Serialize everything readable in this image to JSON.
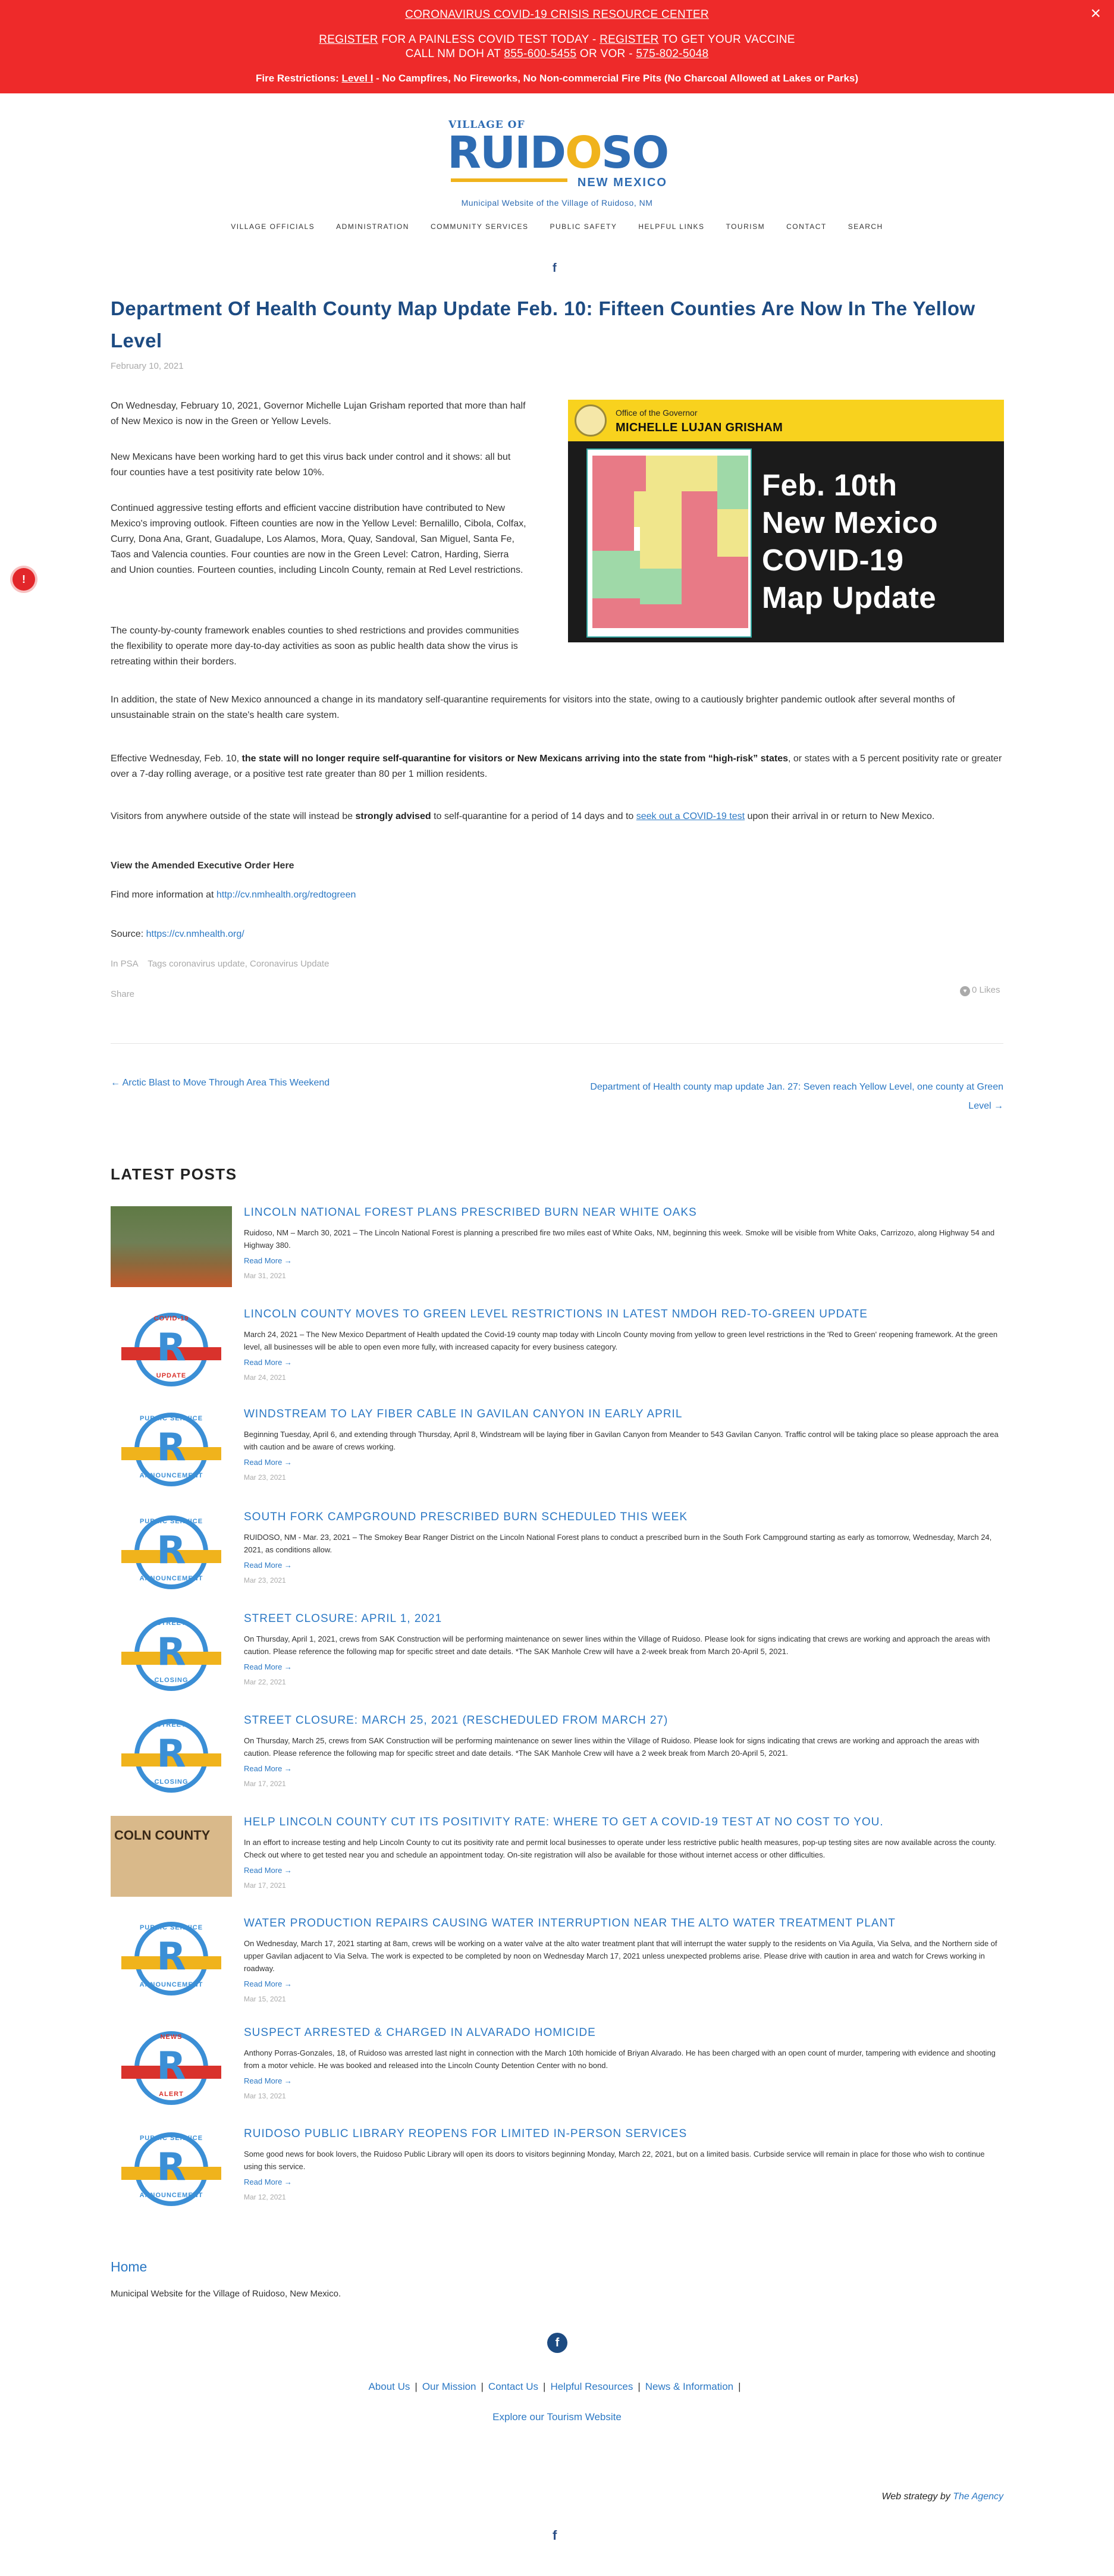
{
  "alert": {
    "line1": "CORONAVIRUS COVID-19 CRISIS RESOURCE CENTER",
    "register1": "REGISTER",
    "line2_mid": " FOR A PAINLESS COVID TEST TODAY - ",
    "register2": "REGISTER",
    "line2_end": " TO GET YOUR VACCINE",
    "line3_a": "CALL NM DOH AT ",
    "phone1": "855-600-5455",
    "line3_b": " OR VOR - ",
    "phone2": "575-802-5048",
    "fire_a": "Fire Restrictions: ",
    "fire_level": "Level I",
    "fire_b": " - No Campfires, No Fireworks, No Non-commercial Fire Pits (No Charcoal Allowed at Lakes or Parks)",
    "close": "×"
  },
  "header": {
    "logo_village": "VILLAGE OF",
    "logo_name_a": "RUID",
    "logo_name_b": "O",
    "logo_name_c": "SO",
    "logo_state": "NEW MEXICO",
    "tagline": "Municipal Website of the Village of Ruidoso, NM",
    "nav": [
      "VILLAGE OFFICIALS",
      "ADMINISTRATION",
      "COMMUNITY SERVICES",
      "PUBLIC SAFETY",
      "HELPFUL LINKS",
      "TOURISM",
      "CONTACT",
      "SEARCH"
    ],
    "fb": "f"
  },
  "article": {
    "title": "Department Of Health County Map Update Feb. 10: Fifteen Counties Are Now In The Yellow Level",
    "date": "February 10, 2021",
    "p1": "On Wednesday, February 10, 2021, Governor Michelle Lujan Grisham reported that more than half of New Mexico is now in the Green or Yellow Levels.",
    "p2": "New Mexicans have been working hard to get this virus back under control and it shows: all but four counties have a test positivity rate below 10%.",
    "p3": "Continued aggressive testing efforts and efficient vaccine distribution have contributed to New Mexico's improving outlook. Fifteen counties are now in the Yellow Level: Bernalillo, Cibola, Colfax, Curry, Dona Ana, Grant, Guadalupe, Los Alamos, Mora, Quay, Sandoval, San Miguel, Santa Fe, Taos and Valencia counties. Four counties are now in the Green Level: Catron, Harding, Sierra and Union counties. Fourteen counties, including Lincoln County, remain at Red Level restrictions.",
    "p4": "The county-by-county framework enables counties to shed restrictions and provides communities the flexibility to operate more day-to-day activities as soon as public health data show the virus is retreating within their borders.",
    "p5": "In addition, the state of New Mexico announced a change in its mandatory self-quarantine requirements for visitors into the state, owing to a cautiously brighter pandemic outlook after several months of unsustainable strain on the state's health care system.",
    "p6_a": "Effective Wednesday, Feb. 10, ",
    "p6_b": "the state will no longer require self-quarantine for visitors or New Mexicans arriving into the state from “high-risk” states",
    "p6_c": ", or states with a 5 percent positivity rate or greater over a 7-day rolling average, or a positive test rate greater than 80 per 1 million residents.",
    "p7_a": "Visitors from anywhere outside of the state will instead be ",
    "p7_b": "strongly advised",
    "p7_c": " to self-quarantine for a period of 14 days and to ",
    "p7_link": "seek out a COVID-19 test",
    "p7_d": " upon their arrival in or return to New Mexico.",
    "order_link": "View the Amended Executive Order Here",
    "more_a": "Find more information at ",
    "more_link": "http://cv.nmhealth.org/redtogreen",
    "source_a": "Source: ",
    "source_link": "https://cv.nmhealth.org/",
    "tags": "In PSA    Tags coronavirus update, Coronavirus Update",
    "share": "Share",
    "likes": "0 Likes",
    "prev": "← Arctic Blast to Move Through Area This Weekend",
    "next": "Department of Health county map update Jan. 27: Seven reach Yellow Level, one county at Green Level →"
  },
  "hero": {
    "office": "Office of the Governor",
    "governor": "MICHELLE LUJAN GRISHAM",
    "headline": [
      "Feb. 10th",
      "New Mexico",
      "COVID-19",
      "Map Update"
    ]
  },
  "latest": {
    "heading": "LATEST POSTS",
    "posts": [
      {
        "title": "Lincoln National Forest plans prescribed burn near White Oaks",
        "excerpt": "Ruidoso, NM – March 30, 2021 – The Lincoln National Forest is planning a prescribed fire two miles east of White Oaks, NM, beginning this week. Smoke will be visible from White Oaks, Carrizozo, along Highway 54 and Highway 380.",
        "more": "Read More →",
        "date": "Mar 31, 2021",
        "thumb": "fire"
      },
      {
        "title": "Lincoln County moves to Green Level restrictions in latest NMDOH Red-to-Green update",
        "excerpt": "March 24, 2021 – The New Mexico Department of Health updated the Covid-19 county map today with Lincoln County moving from yellow to green level restrictions in the 'Red to Green' reopening framework. At the green level, all businesses will be able to open even more fully, with increased capacity for every business category.",
        "more": "Read More →",
        "date": "Mar 24, 2021",
        "thumb": "covid"
      },
      {
        "title": "Windstream to lay fiber cable in Gavilan Canyon in early April",
        "excerpt": "Beginning Tuesday, April 6, and extending through Thursday, April 8, Windstream will be laying fiber in Gavilan Canyon from Meander to 543 Gavilan Canyon. Traffic control will be taking place so please approach the area with caution and be aware of crews working.",
        "more": "Read More →",
        "date": "Mar 23, 2021",
        "thumb": "psa"
      },
      {
        "title": "South Fork Campground prescribed burn scheduled this week",
        "excerpt": "RUIDOSO, NM - Mar. 23, 2021 – The Smokey Bear Ranger District on the Lincoln National Forest plans to conduct a prescribed burn in the South Fork Campground starting as early as tomorrow, Wednesday, March 24, 2021, as conditions allow.",
        "more": "Read More →",
        "date": "Mar 23, 2021",
        "thumb": "psa"
      },
      {
        "title": "Street Closure: April 1, 2021",
        "excerpt": "On Thursday, April 1, 2021, crews from SAK Construction will be performing maintenance on sewer lines within the Village of Ruidoso. Please look for signs indicating that crews are working and approach the areas with caution. Please reference the following map for specific street and date details. *The SAK Manhole Crew will have a 2-week break from March 20-April 5, 2021.",
        "more": "Read More →",
        "date": "Mar 22, 2021",
        "thumb": "street"
      },
      {
        "title": "Street Closure: March 25, 2021 (Rescheduled from March 27)",
        "excerpt": "On Thursday, March 25, crews from SAK Construction will be performing maintenance on sewer lines within the Village of Ruidoso. Please look for signs indicating that crews are working and approach the areas with caution. Please reference the following map for specific street and date details. *The SAK Manhole Crew will have a 2 week break from March 20-April 5, 2021.",
        "more": "Read More →",
        "date": "Mar 17, 2021",
        "thumb": "street"
      },
      {
        "title": "Help Lincoln County cut its positivity rate: Where to get a COVID-19 test at no cost to you.",
        "excerpt": "In an effort to increase testing and help Lincoln County to cut its positivity rate and permit local businesses to operate under less restrictive public health measures, pop-up testing sites are now available across the county. Check out where to get tested near you and schedule an appointment today. On-site registration will also be available for those without internet access or other difficulties.",
        "more": "Read More →",
        "date": "Mar 17, 2021",
        "thumb": "county"
      },
      {
        "title": "Water production repairs causing water interruption near the Alto Water Treatment Plant",
        "excerpt": "On Wednesday, March 17, 2021 starting at 8am, crews will be working on a water valve at the alto water treatment plant that will interrupt the water supply to the residents on Via Aguila, Via Selva, and the Northern side of upper Gavilan adjacent to Via Selva. The work is expected to be completed by noon on Wednesday March 17, 2021 unless unexpected problems arise. Please drive with caution in area and watch for Crews working in roadway.",
        "more": "Read More →",
        "date": "Mar 15, 2021",
        "thumb": "psa"
      },
      {
        "title": "Suspect arrested & charged in Alvarado homicide",
        "excerpt": "Anthony Porras-Gonzales, 18, of Ruidoso was arrested last night in connection with the March 10th homicide of Briyan Alvarado. He has been charged with an open count of murder, tampering with evidence and shooting from a motor vehicle. He was booked and released into the Lincoln County Detention Center with no bond.",
        "more": "Read More →",
        "date": "Mar 13, 2021",
        "thumb": "news"
      },
      {
        "title": "Ruidoso Public Library reopens for limited in-person services",
        "excerpt": "Some good news for book lovers, the Ruidoso Public Library will open its doors to visitors beginning Monday, March 22, 2021, but on a limited basis. Curbside service will remain in place for those who wish to continue using this service.",
        "more": "Read More →",
        "date": "Mar 12, 2021",
        "thumb": "psa"
      }
    ]
  },
  "thumbs": {
    "psa_top": "PUBLIC SERVICE",
    "psa_bottom": "ANNOUNCEMENT",
    "covid_top": "COVID-19",
    "covid_bottom": "UPDATE",
    "street_top": "STREET",
    "street_bottom": "CLOSING",
    "news_top": "NEWS",
    "news_bottom": "ALERT",
    "county_label": "COLN COUNTY",
    "letter": "R"
  },
  "footer": {
    "home": "Home",
    "tagline": "Municipal Website for the Village of Ruidoso, New Mexico.",
    "fb": "f",
    "links": [
      "About Us",
      "Our Mission",
      "Contact Us",
      "Helpful Resources",
      "News & Information"
    ],
    "tourism": "Explore our Tourism Website",
    "credit_a": "Web strategy by ",
    "credit_link": "The Agency",
    "fb_bottom": "f"
  },
  "notification_badge": "!",
  "colors": {
    "alert_bg": "#ee2a2a",
    "title_blue": "#1d4b82",
    "link_blue": "#2b78c4",
    "brand_yellow": "#f0b31c"
  }
}
